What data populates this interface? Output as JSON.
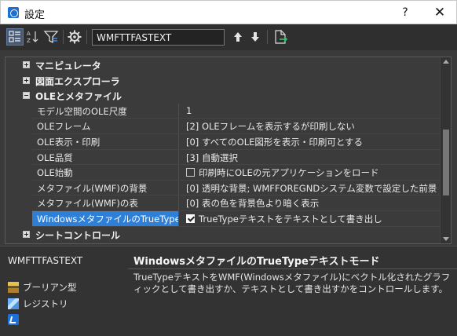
{
  "window": {
    "title": "設定"
  },
  "titlebar_buttons": {
    "help": "?",
    "close": "✕"
  },
  "toolbar": {
    "search_value": "WMFTTFASTEXT"
  },
  "categories": {
    "manipulator": "マニピュレータ",
    "drawing_explorer": "図面エクスプローラ",
    "ole_metafile": "OLEとメタファイル",
    "sheet_control": "シートコントロール"
  },
  "properties": [
    {
      "name": "モデル空間のOLE尺度",
      "value": "1"
    },
    {
      "name": "OLEフレーム",
      "value": "[2] OLEフレームを表示するが印刷しない"
    },
    {
      "name": "OLE表示・印刷",
      "value": "[0] すべてのOLE図形を表示・印刷可とする"
    },
    {
      "name": "OLE品質",
      "value": "[3] 自動選択"
    },
    {
      "name": "OLE始動",
      "value": "印刷時にOLEの元アプリケーションをロード",
      "checked": false
    },
    {
      "name": "メタファイル(WMF)の背景",
      "value": "[0] 透明な背景; WMFFOREGNDシステム変数で設定した前景"
    },
    {
      "name": "メタファイル(WMF)の表",
      "value": "[0] 表の色を背景色より暗く表示"
    },
    {
      "name": "WindowsメタファイルのTrueTypeテキ",
      "value": "TrueTypeテキストをテキストとして書き出し",
      "checked": true
    }
  ],
  "bottom": {
    "variable": "WMFTTFASTEXT",
    "description_title": "WindowsメタファイルのTrueTypeテキストモード",
    "description_text": "TrueTypeテキストをWMF(Windowsメタファイル)にベクトル化されたグラフィックとして書き出すか、テキストとして書き出すかをコントロールします。",
    "type_label": "ブーリアン型",
    "storage_label": "レジストリ"
  }
}
